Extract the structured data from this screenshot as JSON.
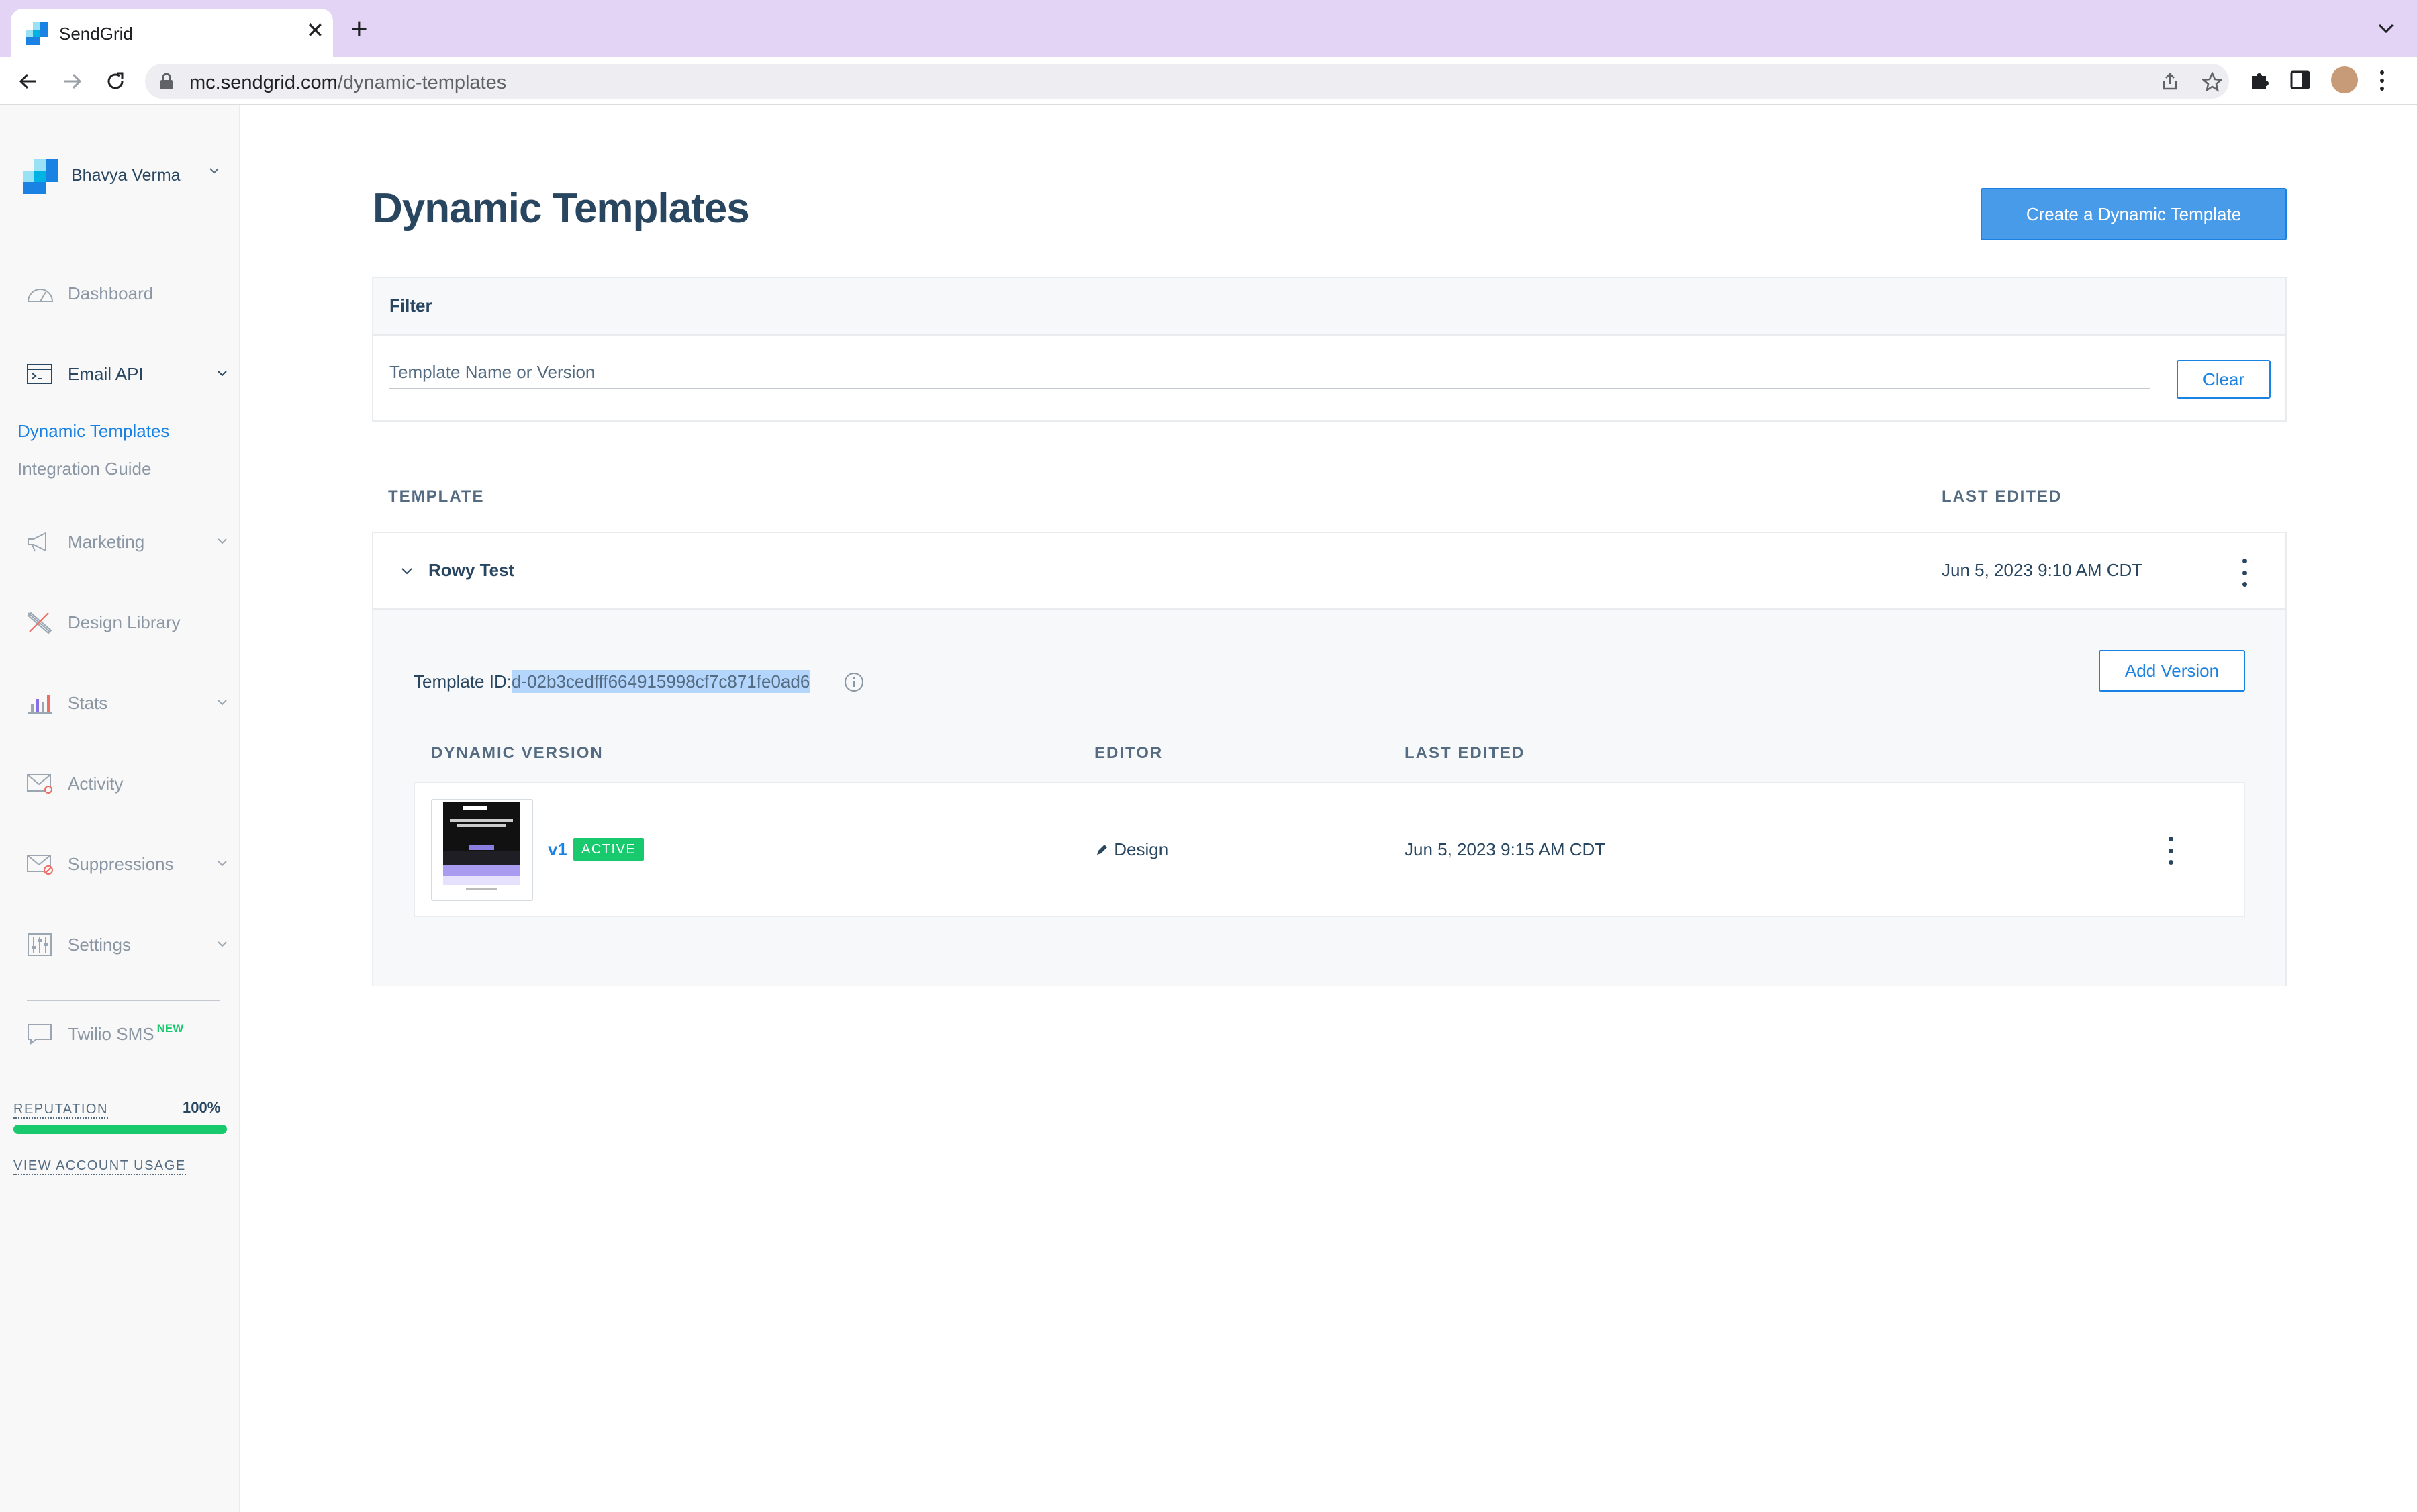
{
  "browser": {
    "tab_title": "SendGrid",
    "url_domain": "mc.sendgrid.com",
    "url_path": "/dynamic-templates"
  },
  "sidebar": {
    "account_name": "Bhavya Verma",
    "items": [
      {
        "label": "Dashboard",
        "icon": "dashboard-icon"
      },
      {
        "label": "Email API",
        "icon": "code-window-icon"
      },
      {
        "label": "Marketing",
        "icon": "megaphone-icon"
      },
      {
        "label": "Design Library",
        "icon": "brush-ruler-icon"
      },
      {
        "label": "Stats",
        "icon": "bar-chart-icon"
      },
      {
        "label": "Activity",
        "icon": "envelope-search-icon"
      },
      {
        "label": "Suppressions",
        "icon": "envelope-block-icon"
      },
      {
        "label": "Settings",
        "icon": "sliders-icon"
      },
      {
        "label": "Twilio SMS",
        "icon": "chat-bubble-icon"
      }
    ],
    "email_api_sub": {
      "dynamic_templates": "Dynamic Templates",
      "integration_guide": "Integration Guide"
    },
    "new_badge": "NEW",
    "reputation_label": "REPUTATION",
    "reputation_value": "100%",
    "reputation_fraction": 1.0,
    "usage_link": "VIEW ACCOUNT USAGE",
    "colors": {
      "active": "#1a82e2",
      "reputation_bar": "#18c96e"
    }
  },
  "main": {
    "title": "Dynamic Templates",
    "create_button": "Create a Dynamic Template",
    "filter": {
      "title": "Filter",
      "placeholder": "Template Name or Version",
      "clear_button": "Clear"
    },
    "table_headers": {
      "template": "TEMPLATE",
      "last_edited": "LAST EDITED"
    },
    "template": {
      "name": "Rowy Test",
      "last_edited": "Jun 5, 2023 9:10 AM CDT",
      "id_label": "Template ID:",
      "id_value": "d-02b3cedfff664915998cf7c871fe0ad6",
      "add_version_button": "Add Version",
      "version_headers": {
        "version": "DYNAMIC VERSION",
        "editor": "EDITOR",
        "last_edited": "LAST EDITED"
      },
      "versions": [
        {
          "name": "v1",
          "status": "ACTIVE",
          "editor": "Design",
          "last_edited": "Jun 5, 2023 9:15 AM CDT"
        }
      ]
    }
  }
}
